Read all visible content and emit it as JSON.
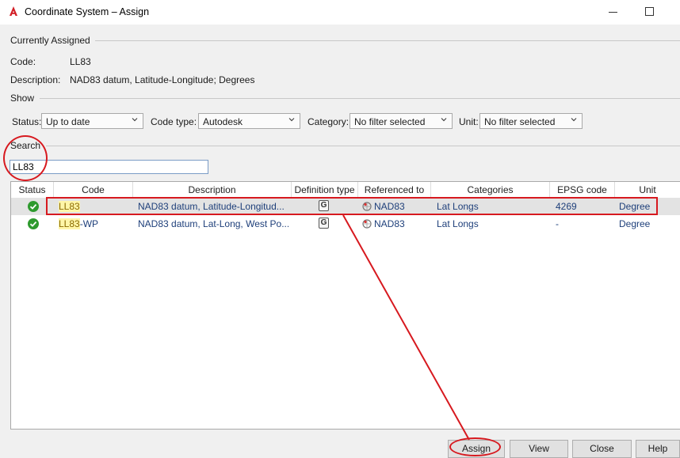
{
  "window": {
    "title": "Coordinate System – Assign"
  },
  "assigned": {
    "heading": "Currently Assigned",
    "code_label": "Code:",
    "code_value": "LL83",
    "desc_label": "Description:",
    "desc_value": "NAD83 datum, Latitude-Longitude; Degrees"
  },
  "show": {
    "heading": "Show",
    "filters": [
      {
        "label": "Status:",
        "value": "Up to date"
      },
      {
        "label": "Code type:",
        "value": "Autodesk"
      },
      {
        "label": "Category:",
        "value": "No filter selected"
      },
      {
        "label": "Unit:",
        "value": "No filter selected"
      }
    ]
  },
  "search": {
    "heading": "Search",
    "value": "LL83"
  },
  "table": {
    "columns": [
      "Status",
      "Code",
      "Description",
      "Definition type",
      "Referenced to",
      "Categories",
      "EPSG code",
      "Unit"
    ],
    "rows": [
      {
        "code_match": "LL83",
        "code_rest": "",
        "description": "NAD83 datum, Latitude-Longitud...",
        "def_type": "G",
        "referenced_to": "NAD83",
        "category": "Lat Longs",
        "epsg": "4269",
        "unit": "Degree",
        "status": "up-to-date"
      },
      {
        "code_match": "LL83",
        "code_rest": "-WP",
        "description": "NAD83 datum, Lat-Long, West Po...",
        "def_type": "G",
        "referenced_to": "NAD83",
        "category": "Lat Longs",
        "epsg": "-",
        "unit": "Degree",
        "status": "up-to-date"
      }
    ]
  },
  "buttons": {
    "assign": "Assign",
    "view": "View",
    "close": "Close",
    "help": "Help"
  },
  "colors": {
    "annotation": "#d7191f",
    "selected_row": "#e3e3e3",
    "search_highlight": "#fff6a8"
  }
}
